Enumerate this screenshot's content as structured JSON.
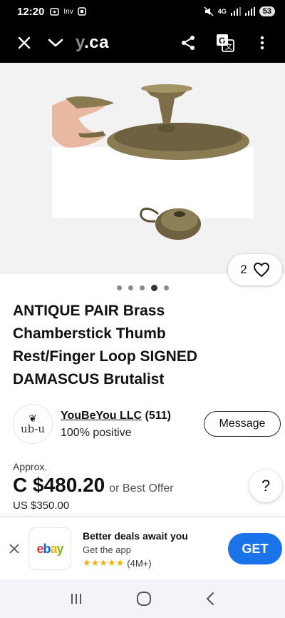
{
  "status_bar": {
    "time": "12:20",
    "left_icons": [
      "notification-icon",
      "inv-icon",
      "screenshot-icon"
    ],
    "network": "4G",
    "battery": "53"
  },
  "browser": {
    "url_faded": "y",
    "url_main": ".ca"
  },
  "listing": {
    "image_count": 5,
    "active_image_index": 3,
    "watch_count": "2",
    "title": "ANTIQUE PAIR Brass Chamberstick Thumb Rest/Finger Loop SIGNED DAMASCUS Brutalist"
  },
  "seller": {
    "logo_text": "ub-u",
    "name": "YouBeYou LLC",
    "feedback": "(511)",
    "positive": "100% positive",
    "message_label": "Message"
  },
  "price": {
    "approx_label": "Approx.",
    "amount": "C $480.20",
    "best_offer": "or Best Offer",
    "usd": "US $350.00",
    "help": "?"
  },
  "app_banner": {
    "logo": [
      "e",
      "b",
      "a",
      "y"
    ],
    "title": "Better deals await you",
    "subtitle": "Get the app",
    "stars": "★★★★★",
    "rating_count": "(4M+)",
    "get_label": "GET"
  },
  "colors": {
    "ebay_e": "#e53238",
    "ebay_b": "#0064d2",
    "ebay_a": "#f5af02",
    "ebay_y": "#86b817",
    "get_button": "#1a73e8"
  }
}
